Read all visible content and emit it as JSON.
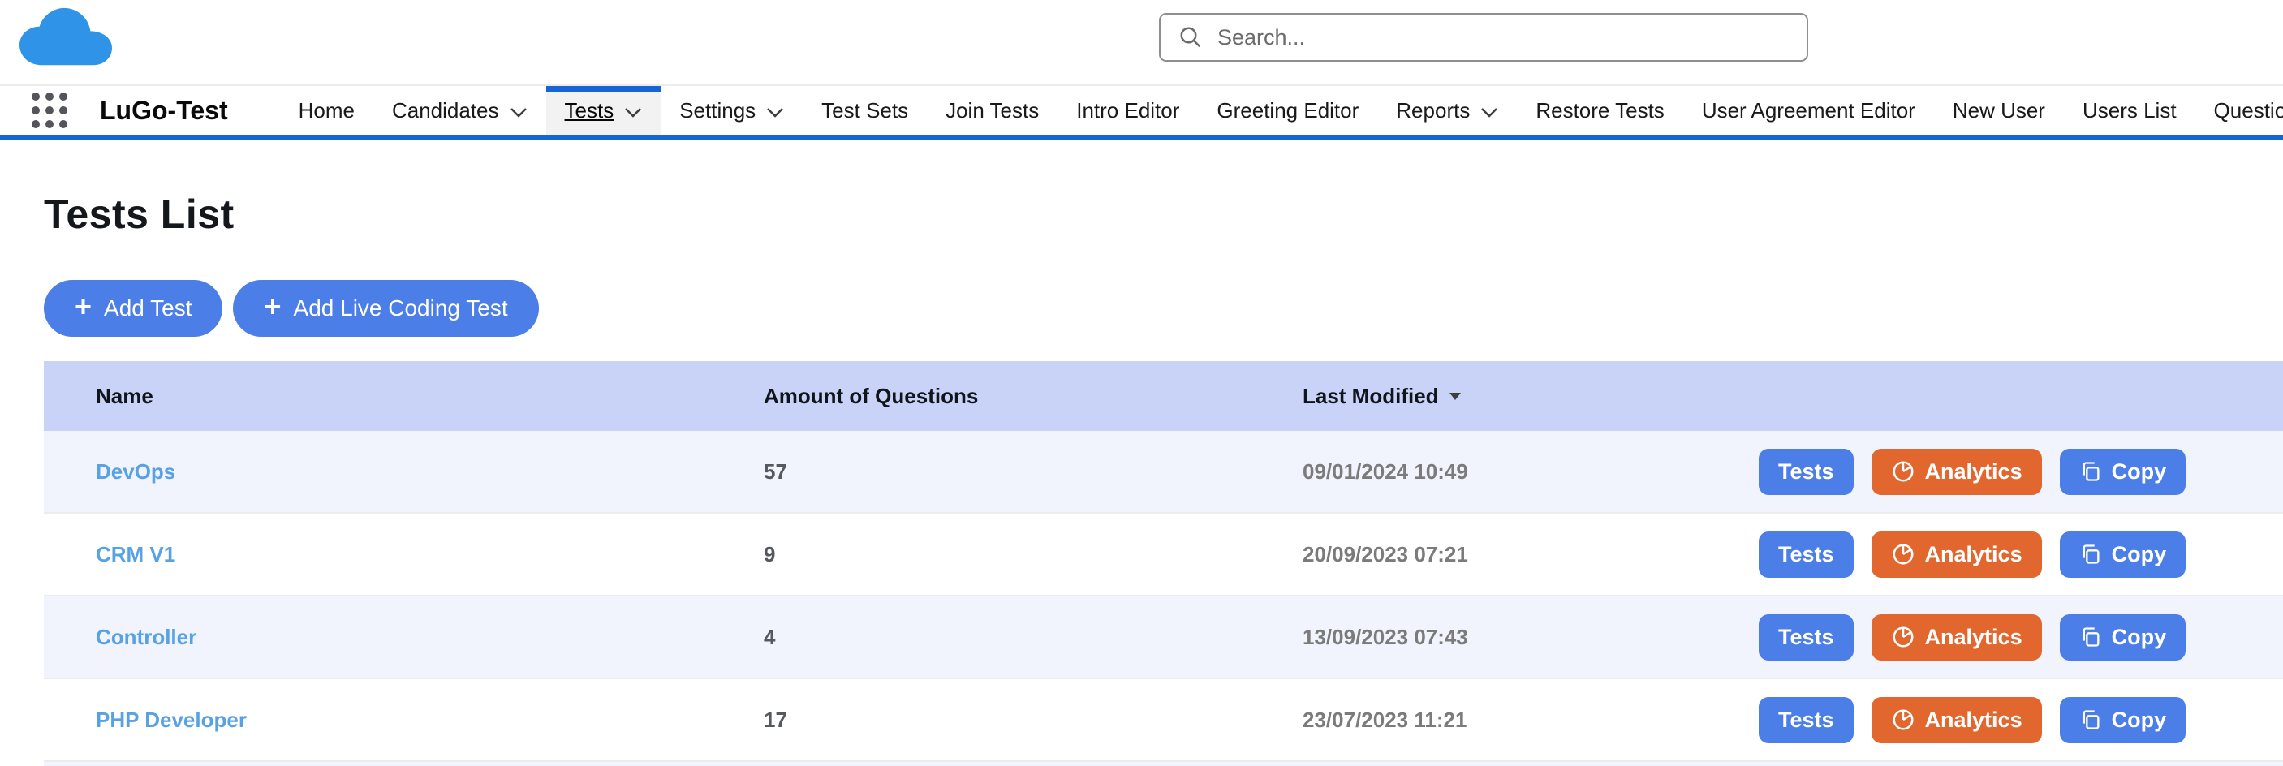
{
  "header": {
    "search_placeholder": "Search..."
  },
  "nav": {
    "app_name": "LuGo-Test",
    "items": [
      {
        "label": "Home"
      },
      {
        "label": "Candidates",
        "has_dropdown": true
      },
      {
        "label": "Tests",
        "has_dropdown": true,
        "active": true
      },
      {
        "label": "Settings",
        "has_dropdown": true
      },
      {
        "label": "Test Sets"
      },
      {
        "label": "Join Tests"
      },
      {
        "label": "Intro Editor"
      },
      {
        "label": "Greeting Editor"
      },
      {
        "label": "Reports",
        "has_dropdown": true
      },
      {
        "label": "Restore Tests"
      },
      {
        "label": "User Agreement Editor"
      },
      {
        "label": "New User"
      },
      {
        "label": "Users List"
      },
      {
        "label": "Questions",
        "truncated": true
      }
    ]
  },
  "page": {
    "title": "Tests List",
    "actions": [
      {
        "label": "Add Test"
      },
      {
        "label": "Add Live Coding Test"
      }
    ]
  },
  "table": {
    "columns": [
      "Name",
      "Amount of Questions",
      "Last Modified"
    ],
    "sort": {
      "column": "Last Modified",
      "direction": "desc"
    },
    "row_actions": [
      "Tests",
      "Analytics",
      "Copy"
    ],
    "rows": [
      {
        "name": "DevOps",
        "questions": "57",
        "modified": "09/01/2024 10:49"
      },
      {
        "name": "CRM V1",
        "questions": "9",
        "modified": "20/09/2023 07:21"
      },
      {
        "name": "Controller",
        "questions": "4",
        "modified": "13/09/2023 07:43"
      },
      {
        "name": "PHP Developer",
        "questions": "17",
        "modified": "23/07/2023 11:21"
      }
    ]
  },
  "icons": {
    "plus": "+",
    "search": "magnifier",
    "cloud_logo": "cloud",
    "app_launcher": "3x3-dot-grid",
    "chevron_down": "v-chevron",
    "sort_desc": "down-triangle",
    "analytics": "pie-chart",
    "copy": "overlapping-squares"
  },
  "colors": {
    "brand_blue": "#1565d6",
    "button_blue": "#4c7ee8",
    "analytics_orange": "#e2672e",
    "table_header_bg": "#c9d3f8",
    "row_alt_bg": "#f1f4fd",
    "link_blue": "#58a2e4",
    "cloud_blue": "#2f93e8"
  }
}
